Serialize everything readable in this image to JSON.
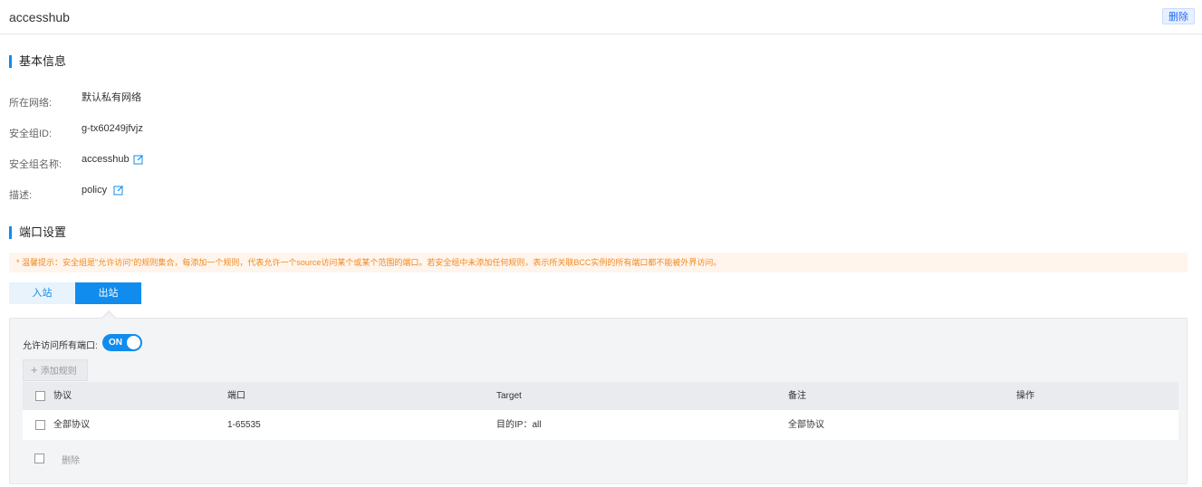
{
  "header": {
    "title": "accesshub",
    "delete_label": "删除"
  },
  "basic_info": {
    "section_title": "基本信息",
    "network_label": "所在网络:",
    "network_value": "默认私有网络",
    "sg_id_label": "安全组ID:",
    "sg_id_value": "g-tx60249jfvjz",
    "sg_name_label": "安全组名称:",
    "sg_name_value": "accesshub",
    "desc_label": "描述:",
    "desc_value": "policy"
  },
  "port_settings": {
    "section_title": "端口设置",
    "tip": "* 温馨提示：安全组是\"允许访问\"的规则集合，每添加一个规则，代表允许一个source访问某个或某个范围的端口。若安全组中未添加任何规则，表示所关联BCC实例的所有端口都不能被外界访问。",
    "tabs": [
      {
        "label": "入站",
        "active": false
      },
      {
        "label": "出站",
        "active": true
      }
    ],
    "allow_all_label": "允许访问所有端口:",
    "toggle_text": "ON",
    "add_rule_label": "添加规则",
    "table": {
      "columns": [
        "协议",
        "端口",
        "Target",
        "备注",
        "操作"
      ],
      "rows": [
        {
          "protocol": "全部协议",
          "port": "1-65535",
          "target": "目的IP：all",
          "remark": "全部协议",
          "op": ""
        }
      ]
    },
    "bulk_delete_label": "删除"
  },
  "colors": {
    "accent": "#108cee",
    "tip_bg": "#fff5ec",
    "tip_text": "#f08a24"
  }
}
